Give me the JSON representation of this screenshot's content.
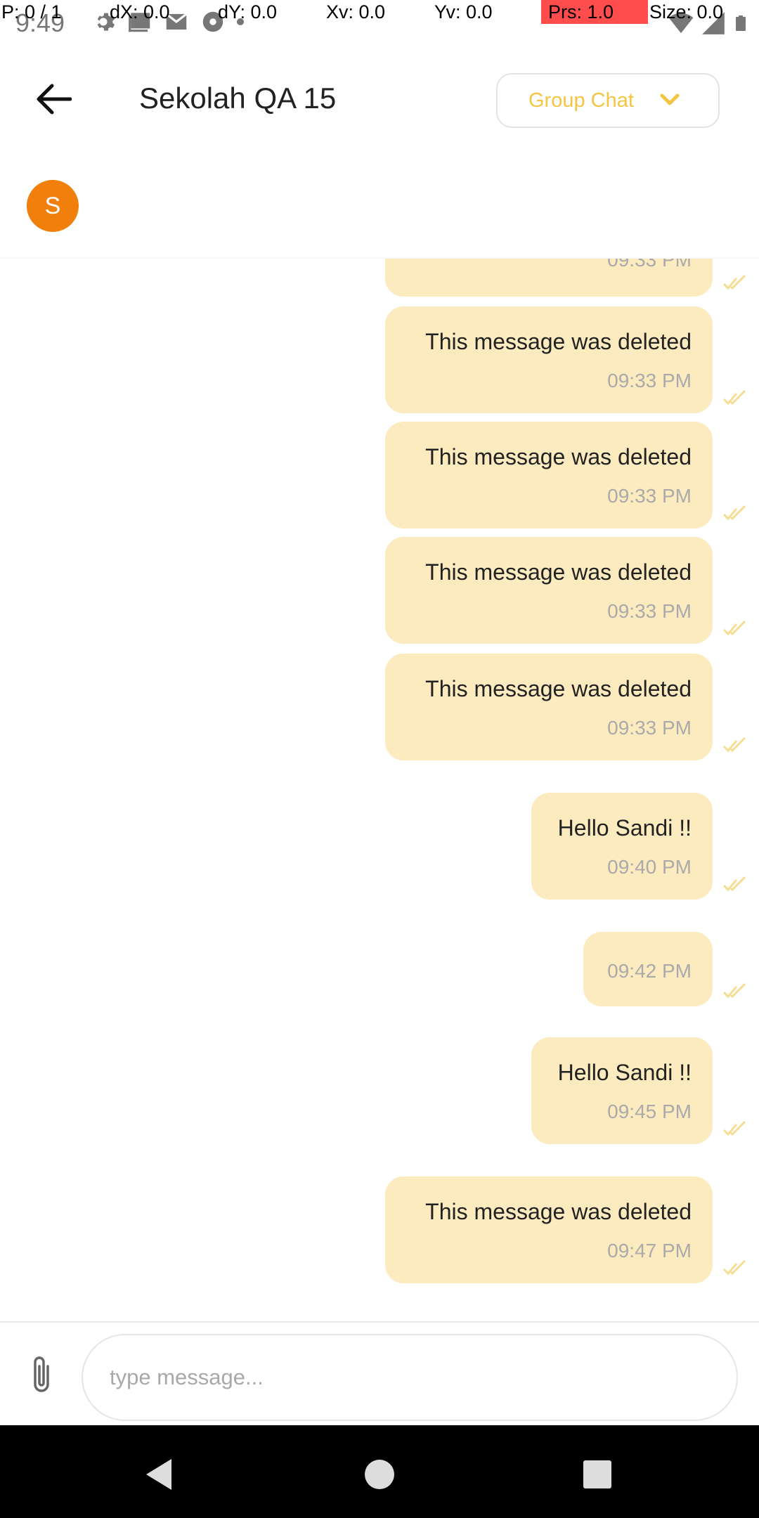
{
  "status_bar": {
    "time": "9:49"
  },
  "pointer_overlay": {
    "p": "P: 0 / 1",
    "dx": "dX: 0.0",
    "dy": "dY: 0.0",
    "xv": "Xv: 0.0",
    "yv": "Yv: 0.0",
    "prs": "Prs: 1.0",
    "size": "Size: 0.0"
  },
  "header": {
    "title": "Sekolah QA 15",
    "chat_type": "Group Chat"
  },
  "participants": [
    {
      "initial": "S",
      "color": "#f07f0c"
    }
  ],
  "messages": [
    {
      "text": "",
      "time": "09:33 PM"
    },
    {
      "text": "This message was deleted",
      "time": "09:33 PM"
    },
    {
      "text": "This message was deleted",
      "time": "09:33 PM"
    },
    {
      "text": "This message was deleted",
      "time": "09:33 PM"
    },
    {
      "text": "This message was deleted",
      "time": "09:33 PM"
    },
    {
      "text": "Hello Sandi !!",
      "time": "09:40 PM"
    },
    {
      "text": "",
      "time": "09:42 PM"
    },
    {
      "text": "Hello Sandi !!",
      "time": "09:45 PM"
    },
    {
      "text": "This message was deleted",
      "time": "09:47 PM"
    }
  ],
  "composer": {
    "placeholder": "type message..."
  },
  "colors": {
    "bubble": "#fdebc0",
    "accent": "#f4c542",
    "avatar": "#f07f0c"
  }
}
